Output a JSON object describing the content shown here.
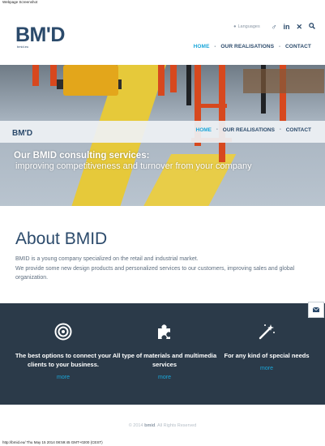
{
  "capture": {
    "title": "Webpage Screenshot",
    "footer": "http://bmid.eu/ Thu May 15 2014 08:59:45 GMT+0200 (CEST)"
  },
  "header": {
    "logo_text": "BM'D",
    "logo_sub": "bmid.eu",
    "languages_label": "Languages",
    "icons": [
      "globe-icon",
      "gender-icon",
      "linkedin-icon",
      "xing-icon",
      "search-icon"
    ]
  },
  "nav": {
    "items": [
      {
        "label": "HOME",
        "active": true
      },
      {
        "label": "OUR REALISATIONS",
        "active": false
      },
      {
        "label": "CONTACT",
        "active": false
      }
    ],
    "separator": "•"
  },
  "sticky": {
    "logo_text": "BM'D"
  },
  "hero": {
    "title": "Our BMID consulting services:",
    "subtitle": "improving competitiveness and turnover from your company"
  },
  "about": {
    "title": "About BMID",
    "line1": "BMID is a young company specialized on the retail and industrial market.",
    "line2": "We provide some new design products and personalized services to our customers, improving sales and global organization."
  },
  "features": [
    {
      "icon": "target-icon",
      "label": "The best options to connect your clients to your business.",
      "more": "more"
    },
    {
      "icon": "puzzle-icon",
      "label": "All type of materials and multimedia services",
      "more": "more"
    },
    {
      "icon": "magic-wand-icon",
      "label": "For any kind of special needs",
      "more": "more"
    }
  ],
  "footer": {
    "prefix": "© 2014",
    "brand": "bmid",
    "suffix": ". All Rights Reserved"
  },
  "colors": {
    "brand": "#2b4a6b",
    "accent": "#1aa6d9",
    "dark_band": "#2b3a49"
  }
}
